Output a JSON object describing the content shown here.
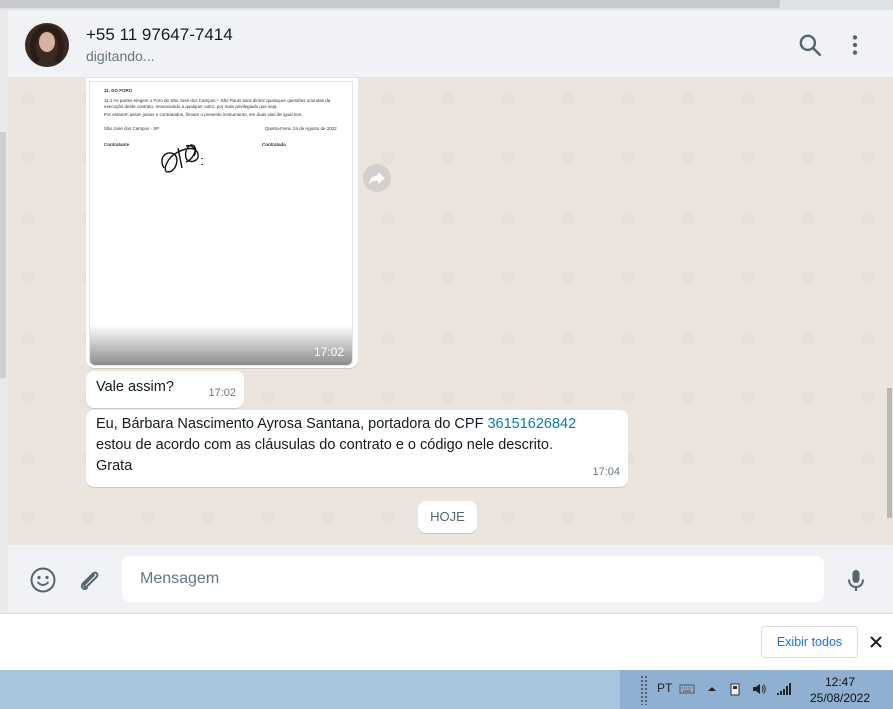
{
  "header": {
    "contact_name": "+55 11 97647-7414",
    "status": "digitando..."
  },
  "document": {
    "lines": [
      "11. DO FORO",
      "11.1 As partes elegem o Foro de São José dos Campos – São Paulo para dirimir quaisquer questões oriundas da",
      "execução deste contrato, renunciando a qualquer outro, por mais privilegiado que seja.",
      "Por estarem assim justos e contratados, firmam o presente instrumento, em duas vias de igual teor.",
      "São José dos Campos - SP",
      "Quarta-Feira, 24 de Agosto de 2022",
      "Contratante",
      "Contratada"
    ],
    "time": "17:02"
  },
  "messages": [
    {
      "text": "Vale assim?",
      "time": "17:02"
    },
    {
      "text_before": "Eu, Bárbara Nascimento Ayrosa Santana, portadora do CPF ",
      "link": "36151626842",
      "text_after_line1": "estou de acordo com as cláusulas do contrato e o código nele descrito.",
      "text_after_line2": "Grata",
      "time": "17:04"
    }
  ],
  "date_chip": "HOJE",
  "composer": {
    "placeholder": "Mensagem"
  },
  "downloads": {
    "show_all": "Exibir todos"
  },
  "taskbar": {
    "lang": "PT",
    "time": "12:47",
    "date": "25/08/2022"
  }
}
